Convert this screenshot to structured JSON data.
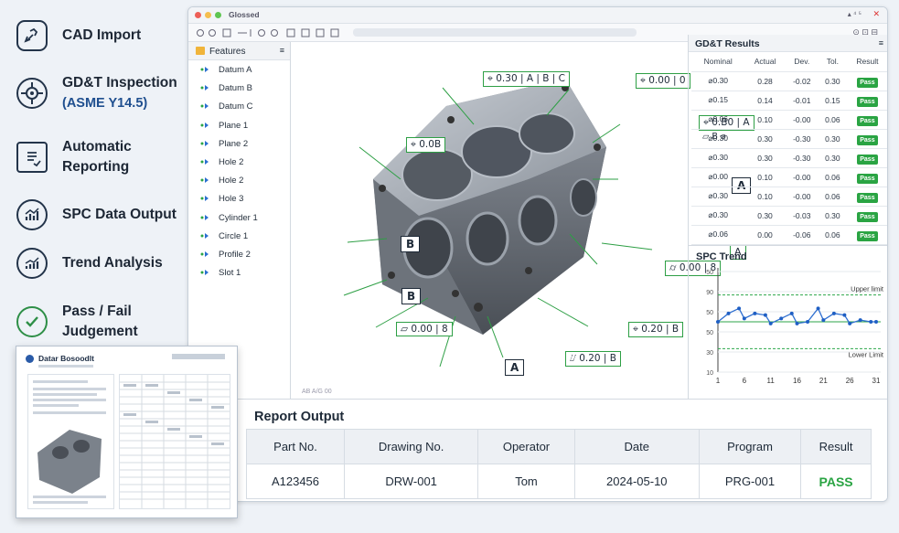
{
  "features": [
    {
      "icon": "cad-import-icon",
      "label": "CAD Import"
    },
    {
      "icon": "gdt-target-icon",
      "label": "GD&T Inspection",
      "sub": "(ASME Y14.5)"
    },
    {
      "icon": "report-document-icon",
      "label": "Automatic",
      "sub2": "Reporting"
    },
    {
      "icon": "spc-chart-icon",
      "label": "SPC Data Output"
    },
    {
      "icon": "trend-chart-icon",
      "label": "Trend Analysis"
    },
    {
      "icon": "pass-check-icon",
      "label": "Pass / Fail",
      "sub2": "Judgement"
    }
  ],
  "window": {
    "title": "Glossed",
    "toolbar_text": "Qp  ⧉  ⧉  ⌸"
  },
  "feature_panel": {
    "title": "Features",
    "items": [
      "Datum A",
      "Datum B",
      "Datum C",
      "Plane 1",
      "Plane 2",
      "Hole 2",
      "Hole 2",
      "Hole 3",
      "Cylinder 1",
      "Circle 1",
      "Profile 2",
      "Slot 1"
    ]
  },
  "viewport": {
    "callouts": {
      "c1": "⌖ 0.30 | A | B | C",
      "c2": "⌖ 0.00 | 0",
      "c3": "⌖ 0.B0 | A",
      "c3b": "⏥ B ⌀",
      "c4": "⌖ 0.0B",
      "c5": "⌭ 0.00 | 8",
      "c6": "⏥ 0.00 | 8",
      "c7": "⌖ 0.20 | B",
      "c8": "⌰ 0.20 | B"
    },
    "datums": {
      "a1": "A",
      "a2": "A",
      "b1": "B",
      "b2": "B",
      "f1": "A"
    },
    "status": "AB  A/G  00"
  },
  "gdt_results": {
    "title": "GD&T Results",
    "columns": [
      "Nominal",
      "Actual",
      "Dev.",
      "Tol.",
      "Result"
    ],
    "rows": [
      [
        "⌀0.30",
        "0.28",
        "-0.02",
        "0.30",
        "Pass"
      ],
      [
        "⌀0.15",
        "0.14",
        "-0.01",
        "0.15",
        "Pass"
      ],
      [
        "⌀0.06",
        "0.10",
        "-0.00",
        "0.06",
        "Pass"
      ],
      [
        "⌀0.30",
        "0.30",
        "-0.30",
        "0.30",
        "Pass"
      ],
      [
        "⌀0.30",
        "0.30",
        "-0.30",
        "0.30",
        "Pass"
      ],
      [
        "⌀0.00",
        "0.10",
        "-0.00",
        "0.06",
        "Pass"
      ],
      [
        "⌀0.30",
        "0.10",
        "-0.00",
        "0.06",
        "Pass"
      ],
      [
        "⌀0.30",
        "0.30",
        "-0.03",
        "0.30",
        "Pass"
      ],
      [
        "⌀0.06",
        "0.00",
        "-0.06",
        "0.06",
        "Pass"
      ]
    ]
  },
  "spc": {
    "title": "SPC Trend",
    "upper_label": "Upper limit",
    "lower_label": "Lower Limit"
  },
  "chart_data": {
    "type": "line",
    "title": "SPC Trend",
    "x": [
      1,
      3,
      5,
      6,
      8,
      10,
      11,
      13,
      15,
      16,
      18,
      20,
      21,
      23,
      25,
      26,
      28,
      30,
      31
    ],
    "values": [
      50,
      55,
      58,
      52,
      55,
      54,
      49,
      52,
      55,
      49,
      50,
      58,
      51,
      55,
      54,
      49,
      51,
      50,
      50
    ],
    "xticks": [
      "1",
      "6",
      "11",
      "16",
      "21",
      "26",
      "31"
    ],
    "yticks": [
      "50",
      "90",
      "50",
      "50",
      "30",
      "10"
    ],
    "upper_limit": 66,
    "lower_limit": 34,
    "colors": {
      "line": "#2e6fd0",
      "limit": "#2ca64a"
    }
  },
  "report": {
    "title": "Report Output",
    "headers": [
      "Part No.",
      "Drawing No.",
      "Operator",
      "Date",
      "Program",
      "Result"
    ],
    "values": [
      "A123456",
      "DRW-001",
      "Tom",
      "2024-05-10",
      "PRG-001",
      "PASS"
    ]
  },
  "report_thumb": {
    "title": "Datar Bosoodlt"
  },
  "colors": {
    "accent": "#2aa443",
    "navy": "#23344a",
    "blue": "#1f4f8f"
  }
}
